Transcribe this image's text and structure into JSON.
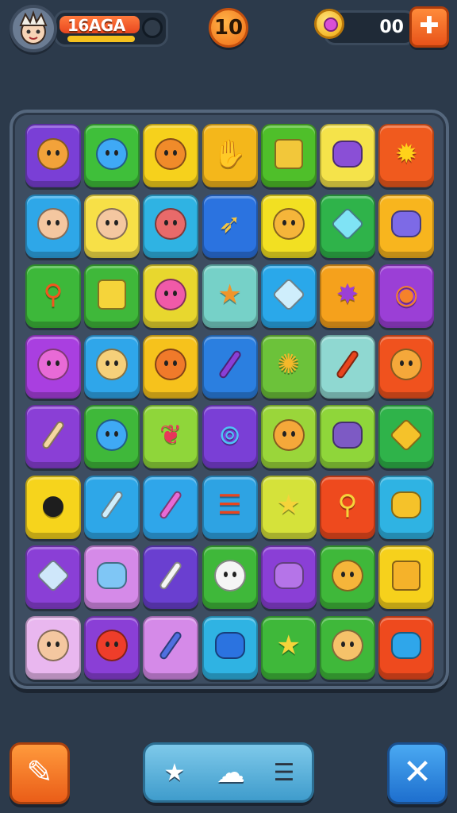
{
  "header": {
    "player_name": "16AGA",
    "level": "10",
    "coins": "00",
    "add_symbol": "✚",
    "player_health_fraction": 0.78,
    "player_xp_fraction": 0.85
  },
  "board": {
    "rows": 8,
    "cols": 7,
    "tiles": [
      [
        {
          "bg": "#7a3fd6",
          "icon": "face",
          "color": "#f2a23a"
        },
        {
          "bg": "#3fbf3a",
          "icon": "face",
          "color": "#3fa9f5"
        },
        {
          "bg": "#f6d11c",
          "icon": "face",
          "color": "#f08b2a"
        },
        {
          "bg": "#f4b71b",
          "icon": "glyph",
          "glyph": "✋",
          "color": "#e8361d"
        },
        {
          "bg": "#4fbf2a",
          "icon": "square",
          "color": "#f2c73a"
        },
        {
          "bg": "#f5e34a",
          "icon": "round-square",
          "color": "#8a4fd6"
        },
        {
          "bg": "#f05a1e",
          "icon": "glyph",
          "glyph": "✹",
          "color": "#ffd21a"
        }
      ],
      [
        {
          "bg": "#2ea7e8",
          "icon": "face",
          "color": "#f4c7a0"
        },
        {
          "bg": "#f7e047",
          "icon": "face",
          "color": "#f4c7a0"
        },
        {
          "bg": "#2fb3e3",
          "icon": "face",
          "color": "#e86a6a"
        },
        {
          "bg": "#2b73e0",
          "icon": "glyph",
          "glyph": "➶",
          "color": "#f5c542"
        },
        {
          "bg": "#f2e022",
          "icon": "face",
          "color": "#f5b53a"
        },
        {
          "bg": "#2fb34a",
          "icon": "diamond",
          "color": "#7fe3f5"
        },
        {
          "bg": "#f8b51e",
          "icon": "round-square",
          "color": "#7d6ae6"
        }
      ],
      [
        {
          "bg": "#3db83a",
          "icon": "glyph",
          "glyph": "⚲",
          "color": "#f2561e"
        },
        {
          "bg": "#3fb83a",
          "icon": "square",
          "color": "#f5d43a"
        },
        {
          "bg": "#e8d72e",
          "icon": "face",
          "color": "#f05aa8"
        },
        {
          "bg": "#76d1c8",
          "icon": "glyph",
          "glyph": "★",
          "color": "#f0952a"
        },
        {
          "bg": "#2aa8ea",
          "icon": "diamond",
          "color": "#cfeefc"
        },
        {
          "bg": "#f5a11c",
          "icon": "glyph",
          "glyph": "✸",
          "color": "#9b3fd6"
        },
        {
          "bg": "#9b3fd6",
          "icon": "glyph",
          "glyph": "◉",
          "color": "#f5822a"
        }
      ],
      [
        {
          "bg": "#a93fe0",
          "icon": "face",
          "color": "#e86ad6"
        },
        {
          "bg": "#2fa6ea",
          "icon": "face",
          "color": "#f5d07a"
        },
        {
          "bg": "#f6c21c",
          "icon": "face",
          "color": "#f07a2a"
        },
        {
          "bg": "#2b7fe0",
          "icon": "stick",
          "color": "#8a3fd6"
        },
        {
          "bg": "#6cc23a",
          "icon": "glyph",
          "glyph": "✺",
          "color": "#f5b82a"
        },
        {
          "bg": "#8fd8d1",
          "icon": "stick",
          "color": "#e8451e"
        },
        {
          "bg": "#f0521e",
          "icon": "face",
          "color": "#f5a83a"
        }
      ],
      [
        {
          "bg": "#8a3fd6",
          "icon": "stick",
          "color": "#f5d7a0"
        },
        {
          "bg": "#3fb83a",
          "icon": "face",
          "color": "#3fa9f5"
        },
        {
          "bg": "#8fd63a",
          "icon": "glyph",
          "glyph": "❦",
          "color": "#e8365a"
        },
        {
          "bg": "#7a3fd6",
          "icon": "glyph",
          "glyph": "⊚",
          "color": "#4fc3f5"
        },
        {
          "bg": "#9ad63a",
          "icon": "face",
          "color": "#f5a83a"
        },
        {
          "bg": "#8fd63a",
          "icon": "round-square",
          "color": "#7d5ac4"
        },
        {
          "bg": "#2fb34a",
          "icon": "diamond",
          "color": "#f5c22a"
        }
      ],
      [
        {
          "bg": "#f6d41c",
          "icon": "glyph",
          "glyph": "●",
          "color": "#1e1e1e"
        },
        {
          "bg": "#2ea7e8",
          "icon": "stick",
          "color": "#cfeefc"
        },
        {
          "bg": "#2fa6ea",
          "icon": "stick",
          "color": "#e86ad6"
        },
        {
          "bg": "#2ea3e3",
          "icon": "glyph",
          "glyph": "☰",
          "color": "#e8451e"
        },
        {
          "bg": "#d5e23a",
          "icon": "glyph",
          "glyph": "★",
          "color": "#f5d43a"
        },
        {
          "bg": "#ee4a1e",
          "icon": "glyph",
          "glyph": "⚲",
          "color": "#f5d43a"
        },
        {
          "bg": "#2fb3e3",
          "icon": "round-square",
          "color": "#f5c22a"
        }
      ],
      [
        {
          "bg": "#8a3fd6",
          "icon": "diamond",
          "color": "#cfe7fa"
        },
        {
          "bg": "#d58ae8",
          "icon": "round-square",
          "color": "#7fc6f5"
        },
        {
          "bg": "#6a3fd0",
          "icon": "stick",
          "color": "#f5f5f5"
        },
        {
          "bg": "#3fb83a",
          "icon": "face",
          "color": "#f5f5f5"
        },
        {
          "bg": "#8a3fd6",
          "icon": "round-square",
          "color": "#b574e8"
        },
        {
          "bg": "#3fb83a",
          "icon": "face",
          "color": "#f5b53a"
        },
        {
          "bg": "#f6d11c",
          "icon": "square",
          "color": "#f5b22a"
        }
      ],
      [
        {
          "bg": "#e9b7ef",
          "icon": "face",
          "color": "#f4c7a0"
        },
        {
          "bg": "#8a3fd6",
          "icon": "face",
          "color": "#ee3d2a"
        },
        {
          "bg": "#d58ae8",
          "icon": "stick",
          "color": "#4f6fe0"
        },
        {
          "bg": "#2fb3e3",
          "icon": "round-square",
          "color": "#2b73e0"
        },
        {
          "bg": "#3fb83a",
          "icon": "glyph",
          "glyph": "★",
          "color": "#f5d43a"
        },
        {
          "bg": "#3fb83a",
          "icon": "face",
          "color": "#f5c26a"
        },
        {
          "bg": "#ee4a1e",
          "icon": "round-square",
          "color": "#2fa6ea"
        }
      ]
    ]
  },
  "bottom": {
    "left_button_glyph": "✎",
    "dock_star_glyph": "★",
    "dock_ghost_glyph": "☁",
    "dock_menu_glyph": "☰",
    "right_button_glyph": "✕"
  },
  "colors": {
    "background": "#2c3a4b",
    "accent_orange": "#f06d17",
    "accent_blue": "#1e6fce"
  }
}
